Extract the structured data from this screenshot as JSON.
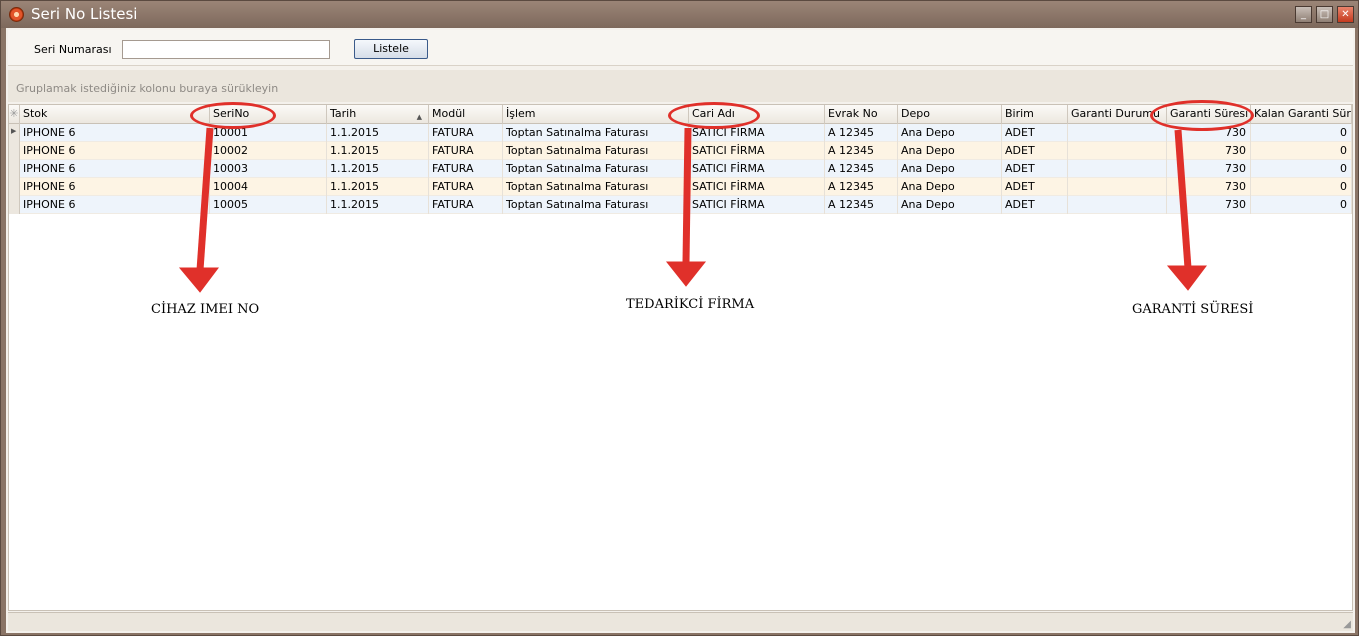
{
  "window": {
    "title": "Seri No Listesi"
  },
  "search": {
    "label": "Seri Numarası",
    "value": "",
    "button": "Listele"
  },
  "group_panel": {
    "text": "Gruplamak istediğiniz kolonu buraya sürükleyin"
  },
  "grid": {
    "columns": [
      "Stok",
      "SeriNo",
      "Tarih",
      "Modül",
      "İşlem",
      "Cari Adı",
      "Evrak No",
      "Depo",
      "Birim",
      "Garanti Durumu",
      "Garanti Süresi",
      "Kalan Garanti Süresi"
    ],
    "rows": [
      [
        "IPHONE 6",
        "10001",
        "1.1.2015",
        "FATURA",
        "Toptan Satınalma Faturası",
        "SATICI FİRMA",
        "A 12345",
        "Ana Depo",
        "ADET",
        "",
        "730",
        "0"
      ],
      [
        "IPHONE 6",
        "10002",
        "1.1.2015",
        "FATURA",
        "Toptan Satınalma Faturası",
        "SATICI FİRMA",
        "A 12345",
        "Ana Depo",
        "ADET",
        "",
        "730",
        "0"
      ],
      [
        "IPHONE 6",
        "10003",
        "1.1.2015",
        "FATURA",
        "Toptan Satınalma Faturası",
        "SATICI FİRMA",
        "A 12345",
        "Ana Depo",
        "ADET",
        "",
        "730",
        "0"
      ],
      [
        "IPHONE 6",
        "10004",
        "1.1.2015",
        "FATURA",
        "Toptan Satınalma Faturası",
        "SATICI FİRMA",
        "A 12345",
        "Ana Depo",
        "ADET",
        "",
        "730",
        "0"
      ],
      [
        "IPHONE 6",
        "10005",
        "1.1.2015",
        "FATURA",
        "Toptan Satınalma Faturası",
        "SATICI FİRMA",
        "A 12345",
        "Ana Depo",
        "ADET",
        "",
        "730",
        "0"
      ]
    ]
  },
  "annotations": {
    "seri_no": "CİHAZ IMEI NO",
    "cari_adi": "TEDARİKCİ FİRMA",
    "garanti_suresi": "GARANTİ SÜRESİ",
    "color": "#e0302a"
  }
}
